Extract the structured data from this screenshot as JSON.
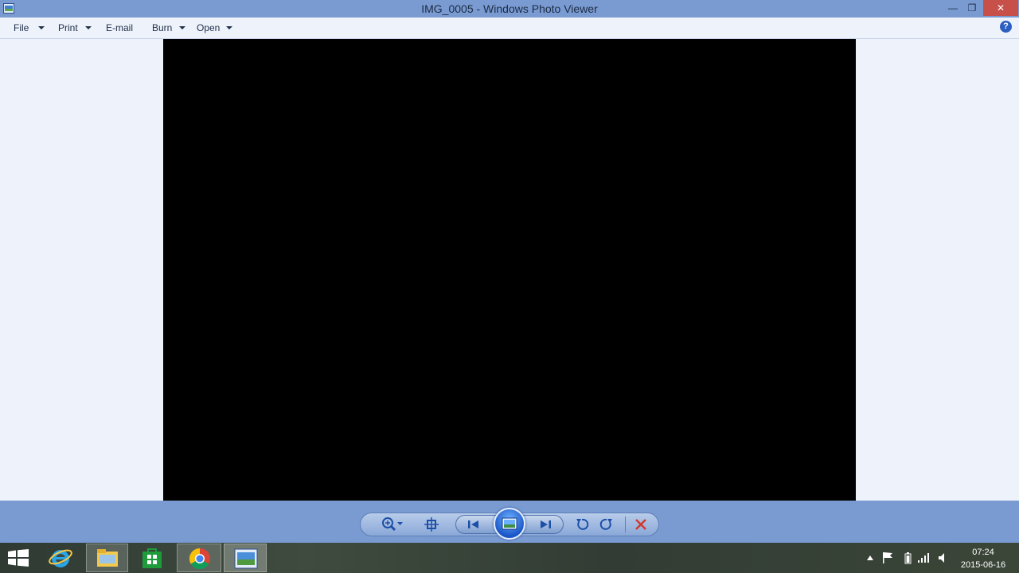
{
  "window": {
    "title": "IMG_0005 - Windows Photo Viewer",
    "close_glyph": "✕",
    "minimize_glyph": "—",
    "maximize_glyph": "❐"
  },
  "menu": {
    "file": "File",
    "print": "Print",
    "email": "E-mail",
    "burn": "Burn",
    "open": "Open",
    "help": "?"
  },
  "toolbar": {
    "icons": [
      "zoom-icon",
      "actual-size-icon",
      "previous-icon",
      "slideshow-icon",
      "next-icon",
      "rotate-counterclockwise-icon",
      "rotate-clockwise-icon",
      "delete-icon"
    ]
  },
  "taskbar": {
    "apps": [
      "start-icon",
      "internet-explorer-icon",
      "file-explorer-icon",
      "store-icon",
      "chrome-icon",
      "photo-viewer-icon"
    ],
    "time": "07:24",
    "date": "2015-06-16"
  },
  "colors": {
    "titlebar": "#7a9bd2",
    "close": "#c7504a",
    "photo": "#000000",
    "background": "#eef2fa"
  }
}
